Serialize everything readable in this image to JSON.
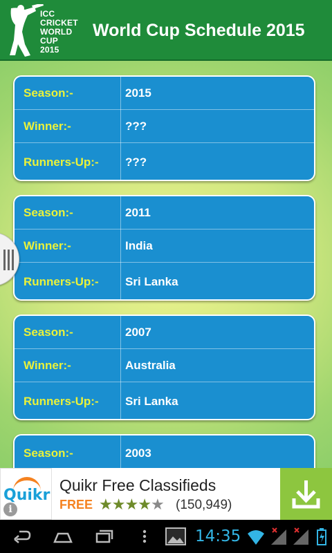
{
  "header": {
    "logo_lines": [
      "ICC",
      "CRICKET",
      "WORLD",
      "CUP",
      "2015"
    ],
    "title": "World Cup Schedule 2015"
  },
  "labels": {
    "season": "Season:-",
    "winner": "Winner:-",
    "runners_up": "Runners-Up:-"
  },
  "entries": [
    {
      "season": "2015",
      "winner": "???",
      "runners_up": "???"
    },
    {
      "season": "2011",
      "winner": "India",
      "runners_up": "Sri Lanka"
    },
    {
      "season": "2007",
      "winner": "Australia",
      "runners_up": "Sri Lanka"
    },
    {
      "season": "2003"
    }
  ],
  "ad": {
    "logo_text": "Quikr",
    "info_icon": "i",
    "title": "Quikr Free Classifieds",
    "price": "FREE",
    "rating": 4,
    "rating_max": 5,
    "review_count": "(150,949)",
    "download_icon": "download-arrow"
  },
  "status": {
    "time": "14:35"
  },
  "colors": {
    "header_green": "#1f8b3a",
    "card_blue": "#1a8fd0",
    "label_yellow": "#eaf23a",
    "clock_blue": "#33b5e5",
    "ad_orange": "#f58220",
    "ad_green": "#8dc63f"
  }
}
